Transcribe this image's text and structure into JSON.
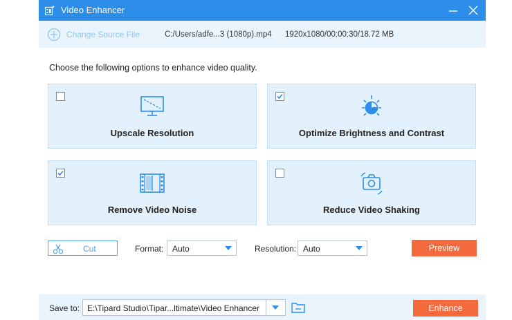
{
  "window": {
    "title": "Video Enhancer",
    "title_icon": "video-enhancer-app-icon",
    "minimize_icon": "minimize-icon",
    "close_icon": "close-icon"
  },
  "source": {
    "change_label": "Change Source File",
    "change_icon": "plus-circle-icon",
    "file_path": "C:/Users/adfe...3 (1080p).mp4",
    "file_meta": "1920x1080/00:00:30/18.72 MB"
  },
  "prompt": "Choose the following options to enhance video quality.",
  "options": [
    {
      "label": "Upscale Resolution",
      "checked": false,
      "icon": "monitor-upscale-icon"
    },
    {
      "label": "Optimize Brightness and Contrast",
      "checked": true,
      "icon": "brightness-icon"
    },
    {
      "label": "Remove Video Noise",
      "checked": true,
      "icon": "film-noise-icon"
    },
    {
      "label": "Reduce Video Shaking",
      "checked": false,
      "icon": "camera-stabilize-icon"
    }
  ],
  "controls": {
    "cut_label": "Cut",
    "cut_icon": "scissors-icon",
    "format_label": "Format:",
    "format_value": "Auto",
    "resolution_label": "Resolution:",
    "resolution_value": "Auto",
    "preview_label": "Preview"
  },
  "save": {
    "label": "Save to:",
    "path": "E:\\Tipard Studio\\Tipar...ltimate\\Video Enhancer",
    "folder_icon": "folder-icon",
    "enhance_label": "Enhance"
  },
  "colors": {
    "accent": "#2c8ee8",
    "card_bg": "#e2f1fc",
    "button_orange": "#f26a3d"
  }
}
